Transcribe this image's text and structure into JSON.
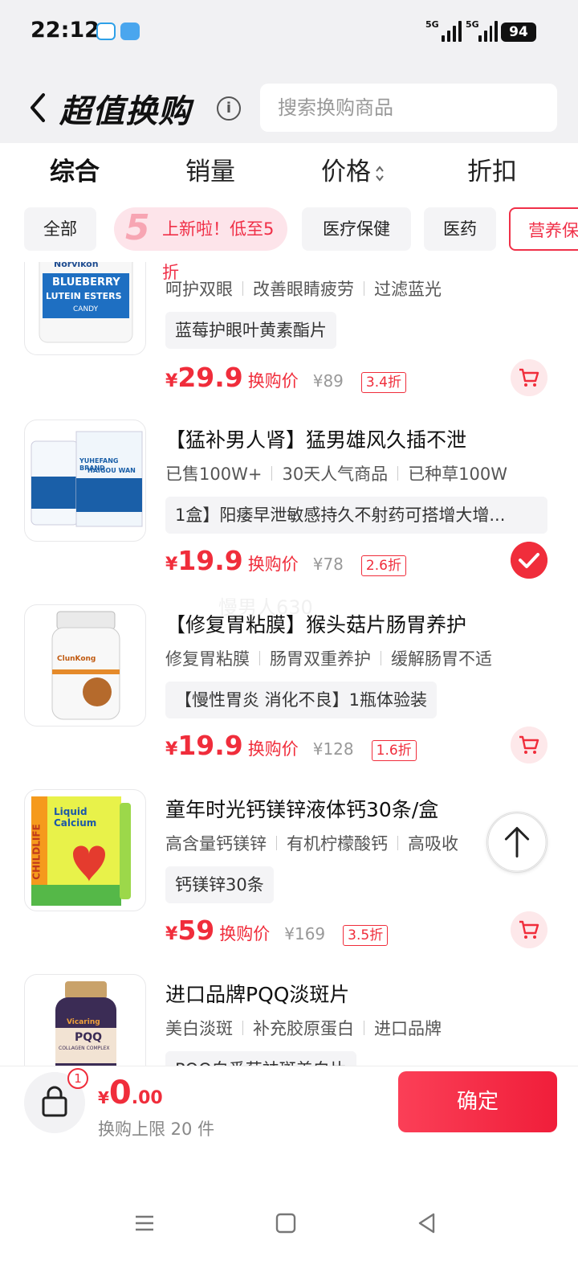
{
  "status_bar": {
    "time": "22:12",
    "network_1": "5G",
    "network_2": "5G",
    "battery": "94"
  },
  "header": {
    "title": "超值换购",
    "search_placeholder": "搜索换购商品"
  },
  "sort_tabs": [
    {
      "label": "综合",
      "active": true
    },
    {
      "label": "销量",
      "active": false
    },
    {
      "label": "价格",
      "active": false
    },
    {
      "label": "折扣",
      "active": false
    }
  ],
  "chips": {
    "all": "全部",
    "promo_number": "5",
    "promo": "上新啦！低至5折",
    "medical_care": "医疗保健",
    "medicine": "医药",
    "nutrition": "营养保"
  },
  "products": [
    {
      "image_text": {
        "brand": "Norvikon",
        "line1": "BLUEBERRY",
        "line2": "LUTEIN ESTERS",
        "line3": "CANDY"
      },
      "title": "",
      "tags": [
        "呵护双眼",
        "改善眼睛疲劳",
        "过滤蓝光"
      ],
      "chip": "蓝莓护眼叶黄素酯片",
      "price_yen": "¥",
      "price": "29.9",
      "price_label": "换购价",
      "original_price": "¥89",
      "discount": "3.4折",
      "selected": false
    },
    {
      "image_text": {
        "line1": "YUHEFANG BRAND",
        "line2": "HAIGOU WAN"
      },
      "title": "【猛补男人肾】猛男雄风久插不泄",
      "tags": [
        "已售100W+",
        "30天人气商品",
        "已种草100W"
      ],
      "chip": "1盒】阳痿早泄敏感持久不射药可搭增大增...",
      "price_yen": "¥",
      "price": "19.9",
      "price_label": "换购价",
      "original_price": "¥78",
      "discount": "2.6折",
      "selected": true
    },
    {
      "image_text": {
        "brand": "ClunKong"
      },
      "title": "【修复胃粘膜】猴头菇片肠胃养护",
      "tags": [
        "修复胃粘膜",
        "肠胃双重养护",
        "缓解肠胃不适"
      ],
      "chip": "【慢性胃炎 消化不良】1瓶体验装",
      "price_yen": "¥",
      "price": "19.9",
      "price_label": "换购价",
      "original_price": "¥128",
      "discount": "1.6折",
      "selected": false
    },
    {
      "image_text": {
        "brand": "CHILDLIFE",
        "line1": "Liquid",
        "line2": "Calcium"
      },
      "title": "童年时光钙镁锌液体钙30条/盒",
      "tags": [
        "高含量钙镁锌",
        "有机柠檬酸钙",
        "高吸收"
      ],
      "chip": "钙镁锌30条",
      "price_yen": "¥",
      "price": "59",
      "price_label": "换购价",
      "original_price": "¥169",
      "discount": "3.5折",
      "selected": false
    },
    {
      "image_text": {
        "brand": "Vicaring",
        "line1": "PQQ",
        "line2": "COLLAGEN COMPLEX"
      },
      "title": "进口品牌PQQ淡斑片",
      "tags": [
        "美白淡斑",
        "补充胶原蛋白",
        "进口品牌"
      ],
      "chip": "PQQ白番茄祛斑美白片",
      "price_yen": "¥",
      "price": "",
      "price_label": "",
      "original_price": "",
      "discount": "",
      "selected": false
    }
  ],
  "watermark": "慢男人630",
  "bottom_bar": {
    "badge": "1",
    "yen": "¥",
    "total_int": "0",
    "total_dec": ".00",
    "limit": "换购上限 20 件",
    "confirm": "确定"
  },
  "colors": {
    "accent": "#f02d3b",
    "chip_bg": "#f4f4f6",
    "header_bg": "#f1f1f3"
  }
}
